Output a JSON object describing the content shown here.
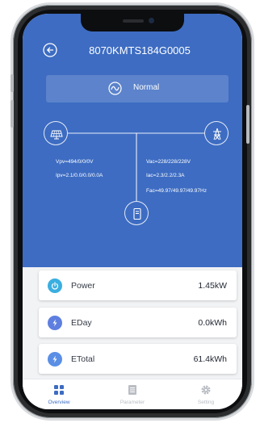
{
  "header": {
    "title": "8070KMTS184G0005",
    "back_icon": "back-arrow-icon"
  },
  "status": {
    "text": "Normal",
    "icon": "wave-icon"
  },
  "flow": {
    "pv_voltage": "Vpv=494/0/0/0V",
    "pv_current": "Ipv=2.1/0.0/0.0/0.0A",
    "ac_voltage": "Vac=228/228/228V",
    "ac_current": "Iac=2.3/2.2/2.3A",
    "ac_frequency": "Fac=49.97/49.97/49.97Hz",
    "icons": {
      "pv": "solar-panel-icon",
      "grid": "grid-tower-icon",
      "inverter": "inverter-icon"
    }
  },
  "metrics": [
    {
      "label": "Power",
      "value": "1.45kW",
      "icon": "power-icon",
      "color": "#3aaee0"
    },
    {
      "label": "EDay",
      "value": "0.0kWh",
      "icon": "lightning-icon",
      "color": "#5e7fe0"
    },
    {
      "label": "ETotal",
      "value": "61.4kWh",
      "icon": "lightning-icon",
      "color": "#5b8fe6"
    }
  ],
  "tabs": [
    {
      "label": "Overview",
      "icon": "grid-four-icon",
      "active": true
    },
    {
      "label": "Parameter",
      "icon": "list-icon",
      "active": false
    },
    {
      "label": "Setting",
      "icon": "gear-icon",
      "active": false
    }
  ],
  "colors": {
    "primary": "#3d6cc2",
    "active_tab": "#3d6cc2",
    "inactive_tab": "#b9bdc4"
  }
}
